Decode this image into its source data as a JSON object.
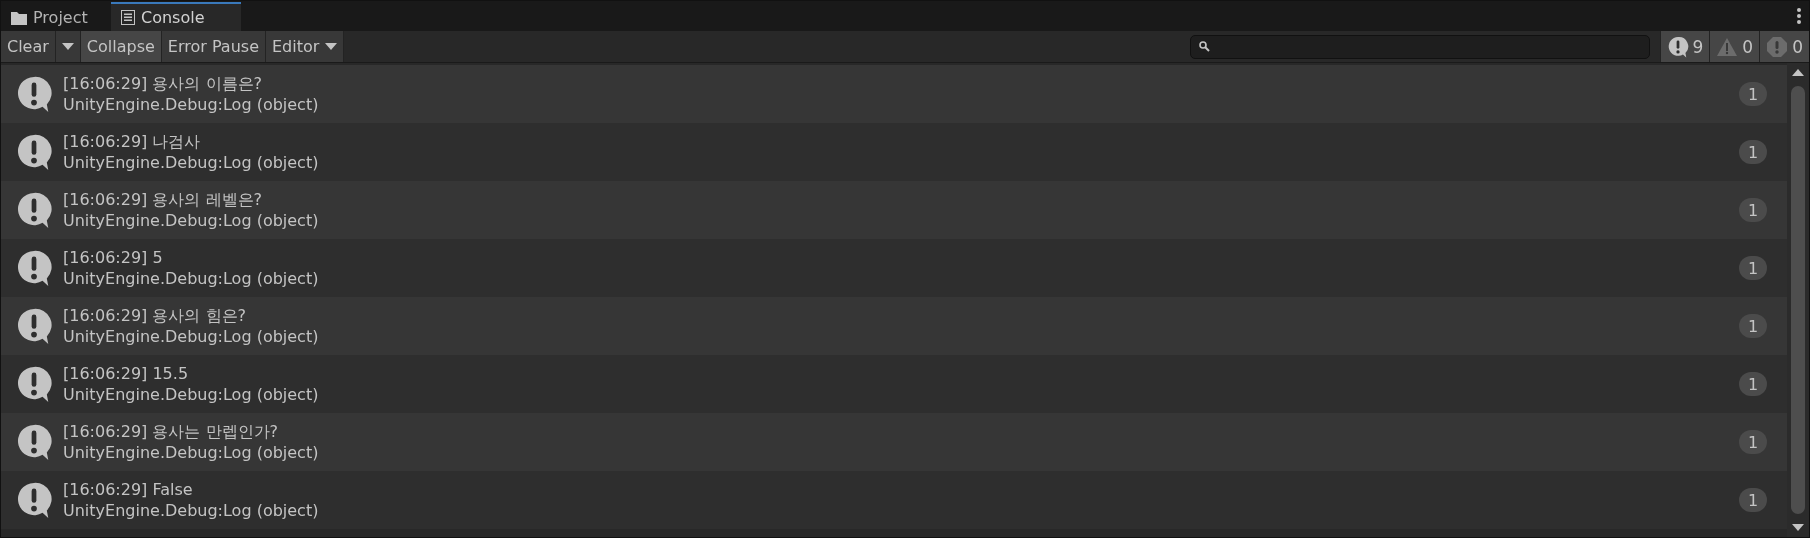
{
  "tabs": [
    {
      "label": "Project",
      "kind": "folder",
      "selected": false
    },
    {
      "label": "Console",
      "kind": "console",
      "selected": true
    }
  ],
  "toolbar": {
    "clear": "Clear",
    "collapse": {
      "label": "Collapse",
      "selected": true
    },
    "error_pause": {
      "label": "Error Pause",
      "selected": false
    },
    "editor": "Editor"
  },
  "counters": [
    {
      "kind": "info",
      "count": "9"
    },
    {
      "kind": "warning",
      "count": "0"
    },
    {
      "kind": "error",
      "count": "0"
    }
  ],
  "logs": [
    {
      "message": "[16:06:29] 용사의 이름은?",
      "trace": "UnityEngine.Debug:Log (object)",
      "count": "1"
    },
    {
      "message": "[16:06:29] 나검사",
      "trace": "UnityEngine.Debug:Log (object)",
      "count": "1"
    },
    {
      "message": "[16:06:29] 용사의 레벨은?",
      "trace": "UnityEngine.Debug:Log (object)",
      "count": "1"
    },
    {
      "message": "[16:06:29] 5",
      "trace": "UnityEngine.Debug:Log (object)",
      "count": "1"
    },
    {
      "message": "[16:06:29] 용사의 힘은?",
      "trace": "UnityEngine.Debug:Log (object)",
      "count": "1"
    },
    {
      "message": "[16:06:29] 15.5",
      "trace": "UnityEngine.Debug:Log (object)",
      "count": "1"
    },
    {
      "message": "[16:06:29] 용사는 만렙인가?",
      "trace": "UnityEngine.Debug:Log (object)",
      "count": "1"
    },
    {
      "message": "[16:06:29] False",
      "trace": "UnityEngine.Debug:Log (object)",
      "count": "1"
    }
  ]
}
